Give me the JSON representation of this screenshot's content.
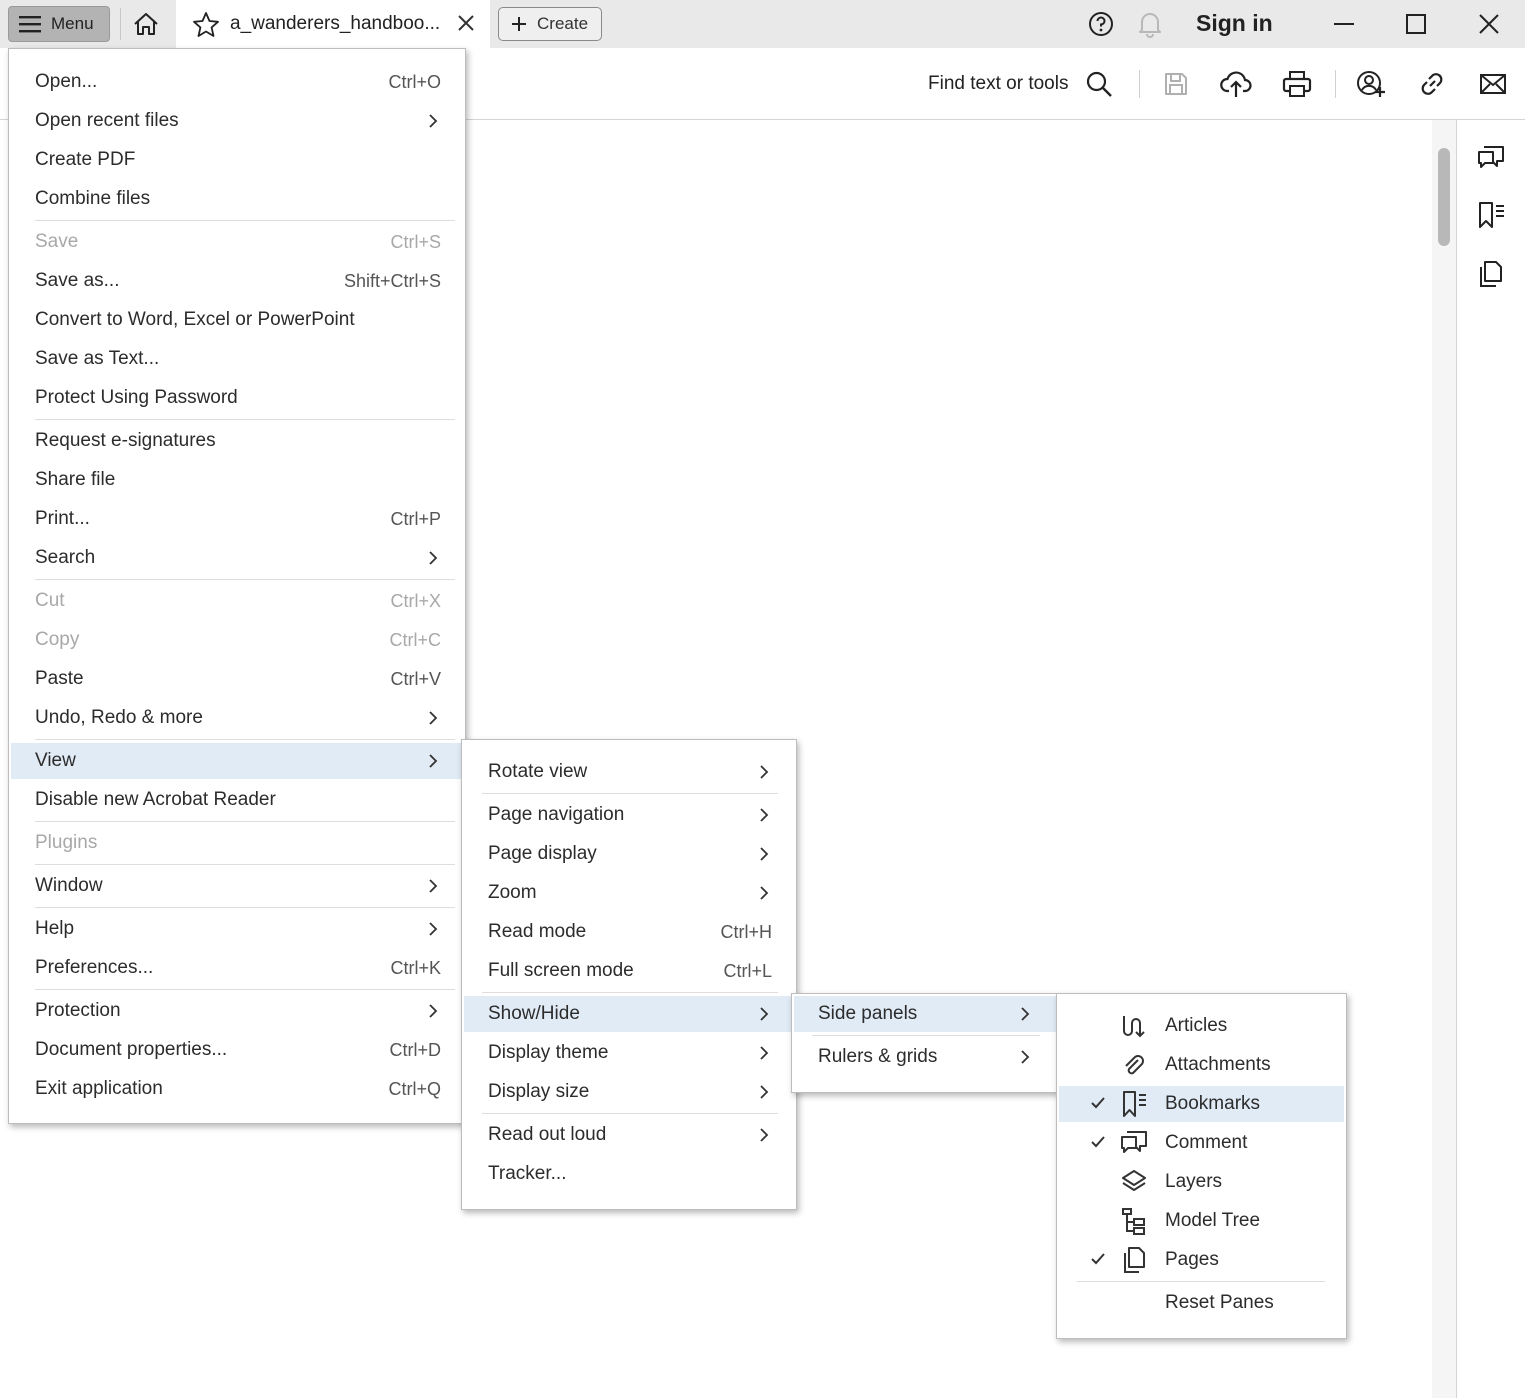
{
  "titlebar": {
    "menu_label": "Menu",
    "tab_title": "a_wanderers_handboo...",
    "create_label": "Create",
    "sign_in": "Sign in"
  },
  "toolbar": {
    "find_label": "Find text or tools"
  },
  "main_menu": {
    "items": [
      {
        "label": "Open...",
        "shortcut": "Ctrl+O"
      },
      {
        "label": "Open recent files"
      },
      {
        "label": "Create PDF"
      },
      {
        "label": "Combine files"
      },
      {
        "label": "Save",
        "shortcut": "Ctrl+S",
        "disabled": true
      },
      {
        "label": "Save as...",
        "shortcut": "Shift+Ctrl+S"
      },
      {
        "label": "Convert to Word, Excel or PowerPoint"
      },
      {
        "label": "Save as Text..."
      },
      {
        "label": "Protect Using Password"
      },
      {
        "label": "Request e-signatures"
      },
      {
        "label": "Share file"
      },
      {
        "label": "Print...",
        "shortcut": "Ctrl+P"
      },
      {
        "label": "Search"
      },
      {
        "label": "Cut",
        "shortcut": "Ctrl+X",
        "disabled": true
      },
      {
        "label": "Copy",
        "shortcut": "Ctrl+C",
        "disabled": true
      },
      {
        "label": "Paste",
        "shortcut": "Ctrl+V"
      },
      {
        "label": "Undo, Redo & more"
      },
      {
        "label": "View",
        "highlighted": true
      },
      {
        "label": "Disable new Acrobat Reader"
      },
      {
        "label": "Plugins",
        "disabled": true
      },
      {
        "label": "Window"
      },
      {
        "label": "Help"
      },
      {
        "label": "Preferences...",
        "shortcut": "Ctrl+K"
      },
      {
        "label": "Protection"
      },
      {
        "label": "Document properties...",
        "shortcut": "Ctrl+D"
      },
      {
        "label": "Exit application",
        "shortcut": "Ctrl+Q"
      }
    ]
  },
  "view_menu": {
    "items": [
      {
        "label": "Rotate view"
      },
      {
        "label": "Page navigation"
      },
      {
        "label": "Page display"
      },
      {
        "label": "Zoom"
      },
      {
        "label": "Read mode",
        "shortcut": "Ctrl+H"
      },
      {
        "label": "Full screen mode",
        "shortcut": "Ctrl+L"
      },
      {
        "label": "Show/Hide",
        "highlighted": true
      },
      {
        "label": "Display theme"
      },
      {
        "label": "Display size"
      },
      {
        "label": "Read out loud"
      },
      {
        "label": "Tracker..."
      }
    ]
  },
  "showhide_menu": {
    "items": [
      {
        "label": "Side panels",
        "highlighted": true
      },
      {
        "label": "Rulers & grids"
      }
    ]
  },
  "sidepanels_menu": {
    "items": [
      {
        "label": "Articles",
        "icon": "articles-icon",
        "checked": false
      },
      {
        "label": "Attachments",
        "icon": "paperclip-icon",
        "checked": false
      },
      {
        "label": "Bookmarks",
        "icon": "bookmark-icon",
        "checked": true,
        "highlighted": true
      },
      {
        "label": "Comment",
        "icon": "comment-icon",
        "checked": true
      },
      {
        "label": "Layers",
        "icon": "layers-icon",
        "checked": false
      },
      {
        "label": "Model Tree",
        "icon": "model-tree-icon",
        "checked": false
      },
      {
        "label": "Pages",
        "icon": "pages-icon",
        "checked": true
      },
      {
        "label": "Reset Panes"
      }
    ]
  },
  "colors": {
    "highlight": "#e1ebf6",
    "titlebar_bg": "#e9e9e9",
    "menu_button_bg": "#b3b3b3"
  }
}
